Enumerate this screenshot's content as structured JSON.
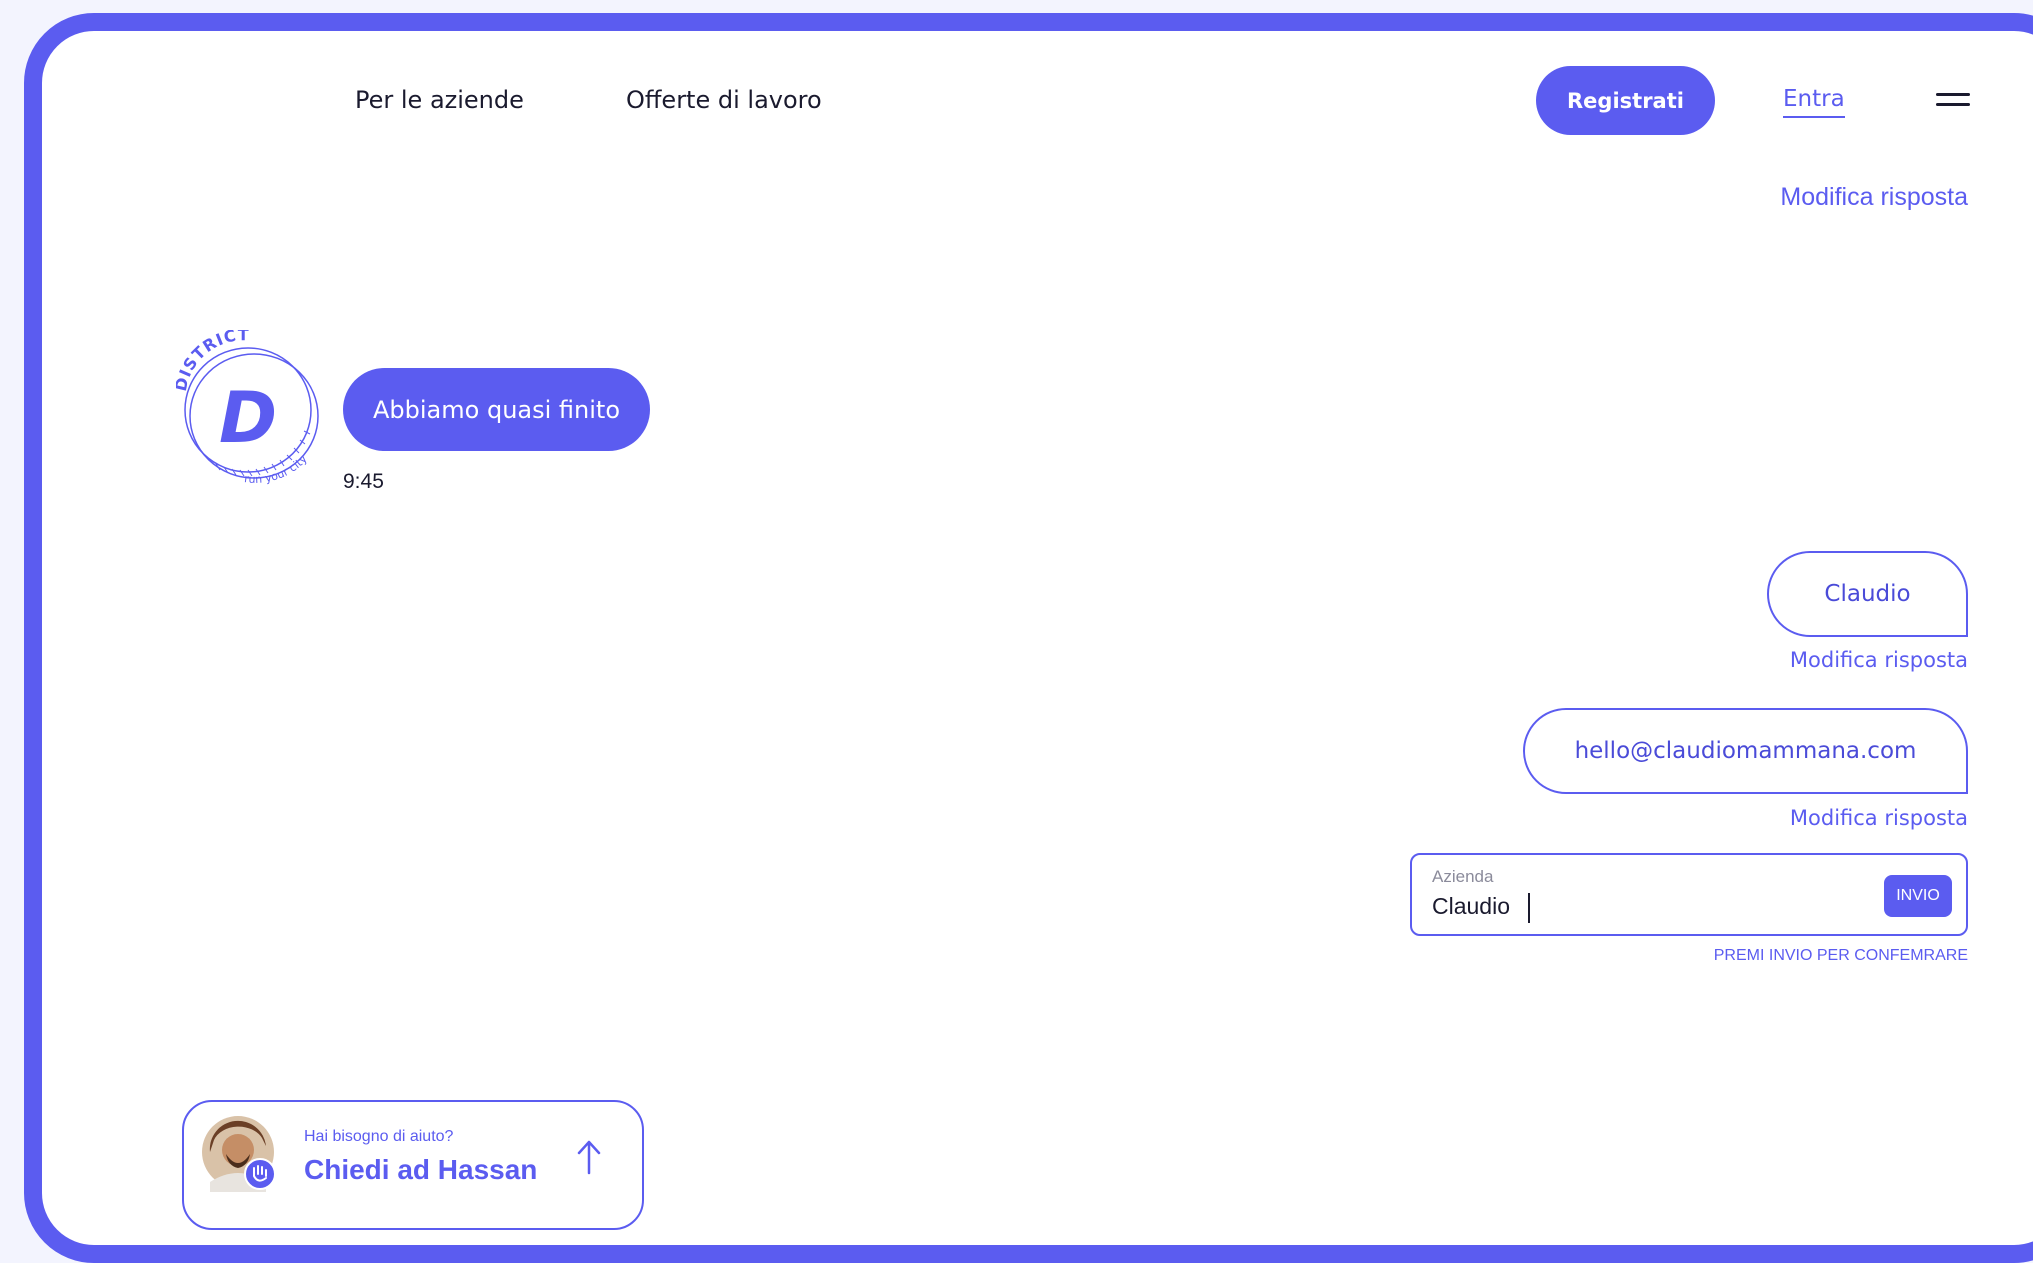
{
  "nav": {
    "items": [
      "Per le aziende",
      "Offerte di lavoro"
    ],
    "register_label": "Registrati",
    "login_label": "Entra",
    "menu_icon": "hamburger-menu-icon"
  },
  "colors": {
    "accent": "#5b5cf0",
    "text": "#1a1a2e",
    "background": "#ffffff"
  },
  "chat": {
    "top_edit_label": "Modifica risposta",
    "logo": {
      "arc_text": "DISTRICT",
      "letter": "D",
      "tagline": "run your city"
    },
    "bot_message": "Abbiamo quasi finito",
    "timestamp": "9:45",
    "user_answers": [
      {
        "text": "Claudio",
        "edit_label": "Modifica risposta"
      },
      {
        "text": "hello@claudiomammana.com",
        "edit_label": "Modifica risposta"
      }
    ],
    "input": {
      "label": "Azienda",
      "value": "Claudio",
      "send_label": "INVIO",
      "hint": "PREMI INVIO PER CONFEMRARE"
    }
  },
  "help": {
    "subtitle": "Hai bisogno di aiuto?",
    "title": "Chiedi ad Hassan",
    "icon": "arrow-up-icon"
  }
}
